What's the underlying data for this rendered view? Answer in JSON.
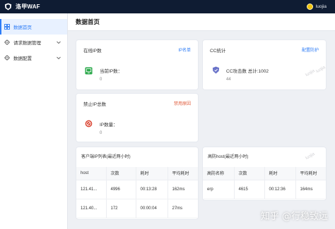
{
  "app": {
    "title": "洛甲WAF",
    "user": "luojia",
    "brand_color": "#0f1c33",
    "accent_color": "#2d7cf6"
  },
  "sidebar": {
    "items": [
      {
        "label": "数据首页",
        "icon": "home-icon",
        "active": true,
        "expandable": false
      },
      {
        "label": "请求数据管理",
        "icon": "gear-icon",
        "active": false,
        "expandable": true
      },
      {
        "label": "数据配置",
        "icon": "gear-icon",
        "active": false,
        "expandable": true
      }
    ]
  },
  "main": {
    "title": "数据首页",
    "online_ip": {
      "title": "在线IP数",
      "link": "IP名单",
      "label": "当前IP数：",
      "value": "0",
      "icon": "monitor-icon"
    },
    "cc": {
      "title": "CC统计",
      "link": "配置防护",
      "label": "CC攻击数 总计:1002",
      "value": "44",
      "icon": "shield-icon"
    },
    "banned_ip": {
      "title": "禁止IP总数",
      "link": "禁用原因",
      "label": "IP数量：",
      "value": "0",
      "icon": "ban-icon"
    },
    "client_table": {
      "title": "客户端IP列表(最近两小时)",
      "columns": [
        "host",
        "次数",
        "耗时",
        "平均耗时"
      ],
      "rows": [
        [
          "121.41...",
          "4996",
          "00:13:28",
          "162ms"
        ],
        [
          "121.40...",
          "172",
          "00:00:04",
          "27ms"
        ]
      ]
    },
    "host_table": {
      "title": "高防host(最近两小时)",
      "columns": [
        "高防名称",
        "次数",
        "耗时",
        "平均耗时"
      ],
      "rows": [
        [
          "erp",
          "4615",
          "00:12:36",
          "164ms"
        ]
      ]
    }
  },
  "watermark": "luojia",
  "footer_watermark": "知乎 @行稳致远"
}
